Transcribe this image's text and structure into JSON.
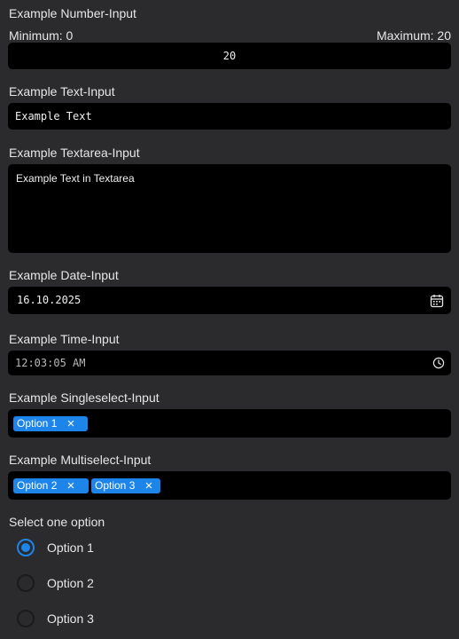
{
  "number_input": {
    "label": "Example Number-Input",
    "min_label": "Minimum: 0",
    "max_label": "Maximum: 20",
    "value": "20"
  },
  "text_input": {
    "label": "Example Text-Input",
    "value": "Example Text"
  },
  "textarea_input": {
    "label": "Example Textarea-Input",
    "value": "Example Text in Textarea"
  },
  "date_input": {
    "label": "Example Date-Input",
    "value": "16.10.2025",
    "icon": "calendar-icon"
  },
  "time_input": {
    "label": "Example Time-Input",
    "value": "12:03:05 AM",
    "icon": "clock-icon"
  },
  "singleselect_input": {
    "label": "Example Singleselect-Input",
    "selected": [
      "Option 1"
    ]
  },
  "multiselect_input": {
    "label": "Example Multiselect-Input",
    "selected": [
      "Option 2",
      "Option 3"
    ]
  },
  "radio_group": {
    "label": "Select one option",
    "options": [
      "Option 1",
      "Option 2",
      "Option 3"
    ],
    "selected": "Option 1"
  },
  "colors": {
    "background": "#2b2b2d",
    "field": "#000000",
    "accent": "#1d84ea"
  }
}
